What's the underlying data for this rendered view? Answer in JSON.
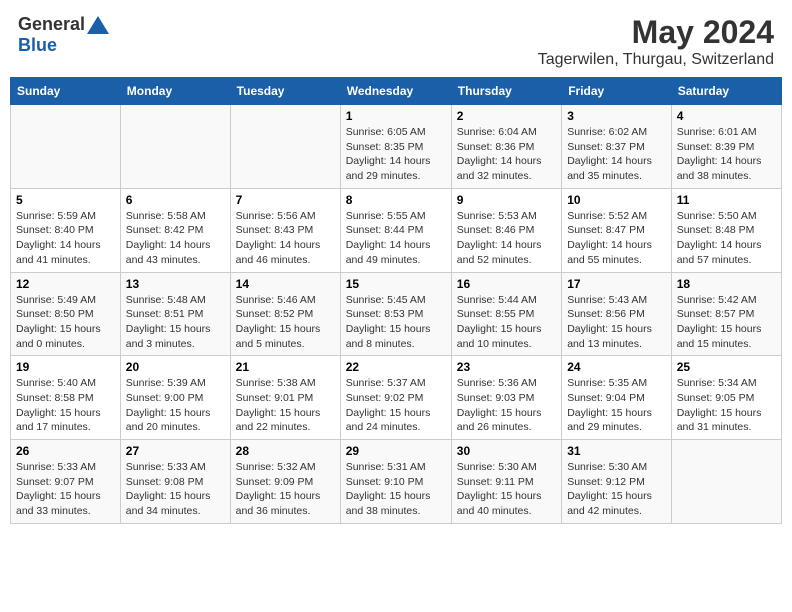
{
  "header": {
    "logo_general": "General",
    "logo_blue": "Blue",
    "main_title": "May 2024",
    "subtitle": "Tagerwilen, Thurgau, Switzerland"
  },
  "columns": [
    "Sunday",
    "Monday",
    "Tuesday",
    "Wednesday",
    "Thursday",
    "Friday",
    "Saturday"
  ],
  "weeks": [
    {
      "row_bg": "odd",
      "days": [
        {
          "num": "",
          "detail": ""
        },
        {
          "num": "",
          "detail": ""
        },
        {
          "num": "",
          "detail": ""
        },
        {
          "num": "1",
          "detail": "Sunrise: 6:05 AM\nSunset: 8:35 PM\nDaylight: 14 hours\nand 29 minutes."
        },
        {
          "num": "2",
          "detail": "Sunrise: 6:04 AM\nSunset: 8:36 PM\nDaylight: 14 hours\nand 32 minutes."
        },
        {
          "num": "3",
          "detail": "Sunrise: 6:02 AM\nSunset: 8:37 PM\nDaylight: 14 hours\nand 35 minutes."
        },
        {
          "num": "4",
          "detail": "Sunrise: 6:01 AM\nSunset: 8:39 PM\nDaylight: 14 hours\nand 38 minutes."
        }
      ]
    },
    {
      "row_bg": "even",
      "days": [
        {
          "num": "5",
          "detail": "Sunrise: 5:59 AM\nSunset: 8:40 PM\nDaylight: 14 hours\nand 41 minutes."
        },
        {
          "num": "6",
          "detail": "Sunrise: 5:58 AM\nSunset: 8:42 PM\nDaylight: 14 hours\nand 43 minutes."
        },
        {
          "num": "7",
          "detail": "Sunrise: 5:56 AM\nSunset: 8:43 PM\nDaylight: 14 hours\nand 46 minutes."
        },
        {
          "num": "8",
          "detail": "Sunrise: 5:55 AM\nSunset: 8:44 PM\nDaylight: 14 hours\nand 49 minutes."
        },
        {
          "num": "9",
          "detail": "Sunrise: 5:53 AM\nSunset: 8:46 PM\nDaylight: 14 hours\nand 52 minutes."
        },
        {
          "num": "10",
          "detail": "Sunrise: 5:52 AM\nSunset: 8:47 PM\nDaylight: 14 hours\nand 55 minutes."
        },
        {
          "num": "11",
          "detail": "Sunrise: 5:50 AM\nSunset: 8:48 PM\nDaylight: 14 hours\nand 57 minutes."
        }
      ]
    },
    {
      "row_bg": "odd",
      "days": [
        {
          "num": "12",
          "detail": "Sunrise: 5:49 AM\nSunset: 8:50 PM\nDaylight: 15 hours\nand 0 minutes."
        },
        {
          "num": "13",
          "detail": "Sunrise: 5:48 AM\nSunset: 8:51 PM\nDaylight: 15 hours\nand 3 minutes."
        },
        {
          "num": "14",
          "detail": "Sunrise: 5:46 AM\nSunset: 8:52 PM\nDaylight: 15 hours\nand 5 minutes."
        },
        {
          "num": "15",
          "detail": "Sunrise: 5:45 AM\nSunset: 8:53 PM\nDaylight: 15 hours\nand 8 minutes."
        },
        {
          "num": "16",
          "detail": "Sunrise: 5:44 AM\nSunset: 8:55 PM\nDaylight: 15 hours\nand 10 minutes."
        },
        {
          "num": "17",
          "detail": "Sunrise: 5:43 AM\nSunset: 8:56 PM\nDaylight: 15 hours\nand 13 minutes."
        },
        {
          "num": "18",
          "detail": "Sunrise: 5:42 AM\nSunset: 8:57 PM\nDaylight: 15 hours\nand 15 minutes."
        }
      ]
    },
    {
      "row_bg": "even",
      "days": [
        {
          "num": "19",
          "detail": "Sunrise: 5:40 AM\nSunset: 8:58 PM\nDaylight: 15 hours\nand 17 minutes."
        },
        {
          "num": "20",
          "detail": "Sunrise: 5:39 AM\nSunset: 9:00 PM\nDaylight: 15 hours\nand 20 minutes."
        },
        {
          "num": "21",
          "detail": "Sunrise: 5:38 AM\nSunset: 9:01 PM\nDaylight: 15 hours\nand 22 minutes."
        },
        {
          "num": "22",
          "detail": "Sunrise: 5:37 AM\nSunset: 9:02 PM\nDaylight: 15 hours\nand 24 minutes."
        },
        {
          "num": "23",
          "detail": "Sunrise: 5:36 AM\nSunset: 9:03 PM\nDaylight: 15 hours\nand 26 minutes."
        },
        {
          "num": "24",
          "detail": "Sunrise: 5:35 AM\nSunset: 9:04 PM\nDaylight: 15 hours\nand 29 minutes."
        },
        {
          "num": "25",
          "detail": "Sunrise: 5:34 AM\nSunset: 9:05 PM\nDaylight: 15 hours\nand 31 minutes."
        }
      ]
    },
    {
      "row_bg": "odd",
      "days": [
        {
          "num": "26",
          "detail": "Sunrise: 5:33 AM\nSunset: 9:07 PM\nDaylight: 15 hours\nand 33 minutes."
        },
        {
          "num": "27",
          "detail": "Sunrise: 5:33 AM\nSunset: 9:08 PM\nDaylight: 15 hours\nand 34 minutes."
        },
        {
          "num": "28",
          "detail": "Sunrise: 5:32 AM\nSunset: 9:09 PM\nDaylight: 15 hours\nand 36 minutes."
        },
        {
          "num": "29",
          "detail": "Sunrise: 5:31 AM\nSunset: 9:10 PM\nDaylight: 15 hours\nand 38 minutes."
        },
        {
          "num": "30",
          "detail": "Sunrise: 5:30 AM\nSunset: 9:11 PM\nDaylight: 15 hours\nand 40 minutes."
        },
        {
          "num": "31",
          "detail": "Sunrise: 5:30 AM\nSunset: 9:12 PM\nDaylight: 15 hours\nand 42 minutes."
        },
        {
          "num": "",
          "detail": ""
        }
      ]
    }
  ]
}
